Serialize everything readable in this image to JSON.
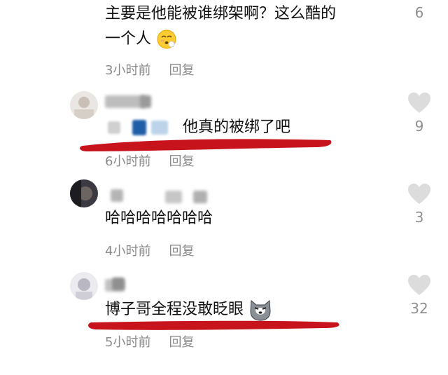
{
  "comments": [
    {
      "text_line1": "主要是他能被谁绑架啊？这么酷的",
      "text_line2": "一个人",
      "emoji": "flushed-face-emoji",
      "time": "3小时前",
      "reply": "回复",
      "likes": "6"
    },
    {
      "text": "他真的被绑了吧",
      "time": "6小时前",
      "reply": "回复",
      "likes": "9",
      "underline_color": "#c7141c"
    },
    {
      "text": "哈哈哈哈哈哈哈",
      "time": "4小时前",
      "reply": "回复",
      "likes": "3"
    },
    {
      "text": "博子哥全程没敢眨眼",
      "emoji": "dog-face-emoji",
      "time": "5小时前",
      "reply": "回复",
      "likes": "32",
      "underline_color": "#c7141c"
    }
  ],
  "colors": {
    "text": "#111111",
    "meta": "#8a8a8a",
    "heart": "#dcdcdc",
    "highlight": "#c7141c"
  }
}
